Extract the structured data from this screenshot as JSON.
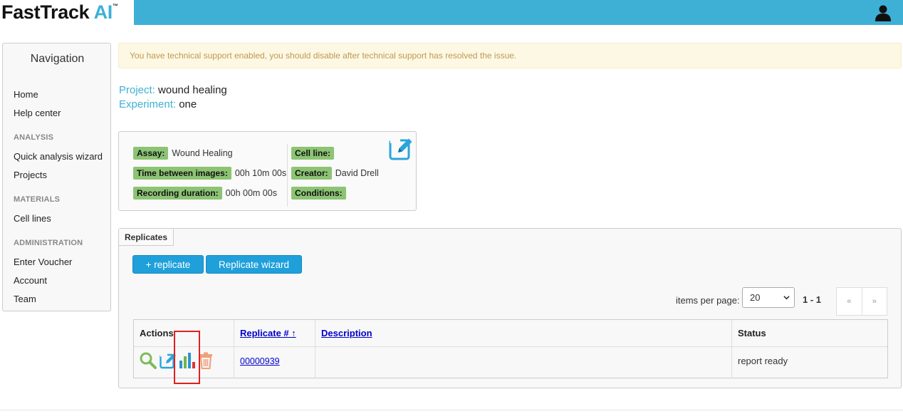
{
  "header": {
    "logo_main": "FastTrack ",
    "logo_ai": "AI",
    "logo_tm": "™",
    "user_icon": "user-icon"
  },
  "sidebar": {
    "title": "Navigation",
    "items": [
      {
        "label": "Home"
      },
      {
        "label": "Help center"
      },
      {
        "section": "ANALYSIS"
      },
      {
        "label": "Quick analysis wizard"
      },
      {
        "label": "Projects"
      },
      {
        "section": "MATERIALS"
      },
      {
        "label": "Cell lines"
      },
      {
        "section": "ADMINISTRATION"
      },
      {
        "label": "Enter Voucher"
      },
      {
        "label": "Account"
      },
      {
        "label": "Team"
      }
    ]
  },
  "alert": {
    "text": "You have technical support enabled, you should disable after technical support has resolved the issue."
  },
  "project": {
    "project_key": "Project:",
    "project_value": "wound healing",
    "experiment_key": "Experiment:",
    "experiment_value": "one"
  },
  "experiment_card": {
    "assay_label": "Assay:",
    "assay_value": "Wound Healing",
    "time_label": "Time between images:",
    "time_value": "00h 10m 00s",
    "duration_label": "Recording duration:",
    "duration_value": "00h 00m 00s",
    "cell_line_label": "Cell line:",
    "cell_line_value": "",
    "creator_label": "Creator:",
    "creator_value": "David Drell",
    "conditions_label": "Conditions:",
    "conditions_value": "",
    "edit_icon": "edit-icon"
  },
  "replicates": {
    "tab_label": "Replicates",
    "add_button": "+ replicate",
    "wizard_button": "Replicate wizard",
    "items_per_page_label": "items per page:",
    "items_per_page_value": "20",
    "page_range": "1 - 1",
    "pager_prev": "«",
    "pager_next": "»",
    "columns": {
      "actions": "Actions",
      "replicate": "Replicate # ↑",
      "description": "Description",
      "status": "Status"
    },
    "rows": [
      {
        "replicate": "00000939",
        "description": "",
        "status": "report ready",
        "actions": [
          "view-icon",
          "edit-icon",
          "chart-icon",
          "delete-icon"
        ]
      }
    ]
  },
  "colors": {
    "header": "#3eb0d5",
    "button": "#1fa0db",
    "tag": "#8cc474",
    "alert_bg": "#fcf8e3",
    "alert_text": "#c09853",
    "highlight": "#e02020"
  }
}
